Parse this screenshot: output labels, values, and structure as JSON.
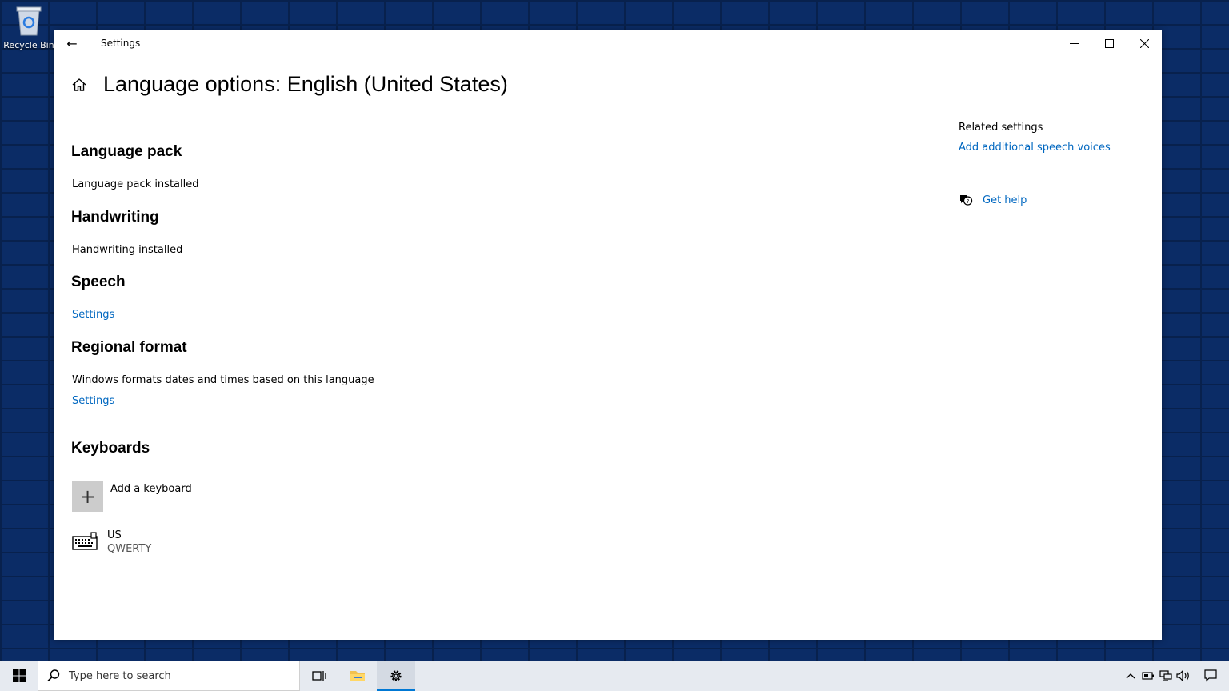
{
  "desktop": {
    "recycle_bin_label": "Recycle Bin"
  },
  "window": {
    "title": "Settings",
    "back_icon": "←",
    "minimize_icon": "—",
    "maximize_icon": "☐",
    "close_icon": "✕"
  },
  "page": {
    "title": "Language options: English (United States)"
  },
  "sections": {
    "language_pack": {
      "heading": "Language pack",
      "status": "Language pack installed"
    },
    "handwriting": {
      "heading": "Handwriting",
      "status": "Handwriting installed"
    },
    "speech": {
      "heading": "Speech",
      "settings_link": "Settings"
    },
    "regional_format": {
      "heading": "Regional format",
      "description": "Windows formats dates and times based on this language",
      "settings_link": "Settings"
    },
    "keyboards": {
      "heading": "Keyboards",
      "add_label": "Add a keyboard",
      "add_icon": "+",
      "items": [
        {
          "name": "US",
          "layout": "QWERTY"
        }
      ]
    }
  },
  "related": {
    "heading": "Related settings",
    "speech_voices_link": "Add additional speech voices",
    "get_help": "Get help"
  },
  "taskbar": {
    "search_placeholder": "Type here to search",
    "accent_color": "#0078d4"
  },
  "colors": {
    "link": "#0067c0",
    "desktop_bg": "#0b2c66"
  }
}
